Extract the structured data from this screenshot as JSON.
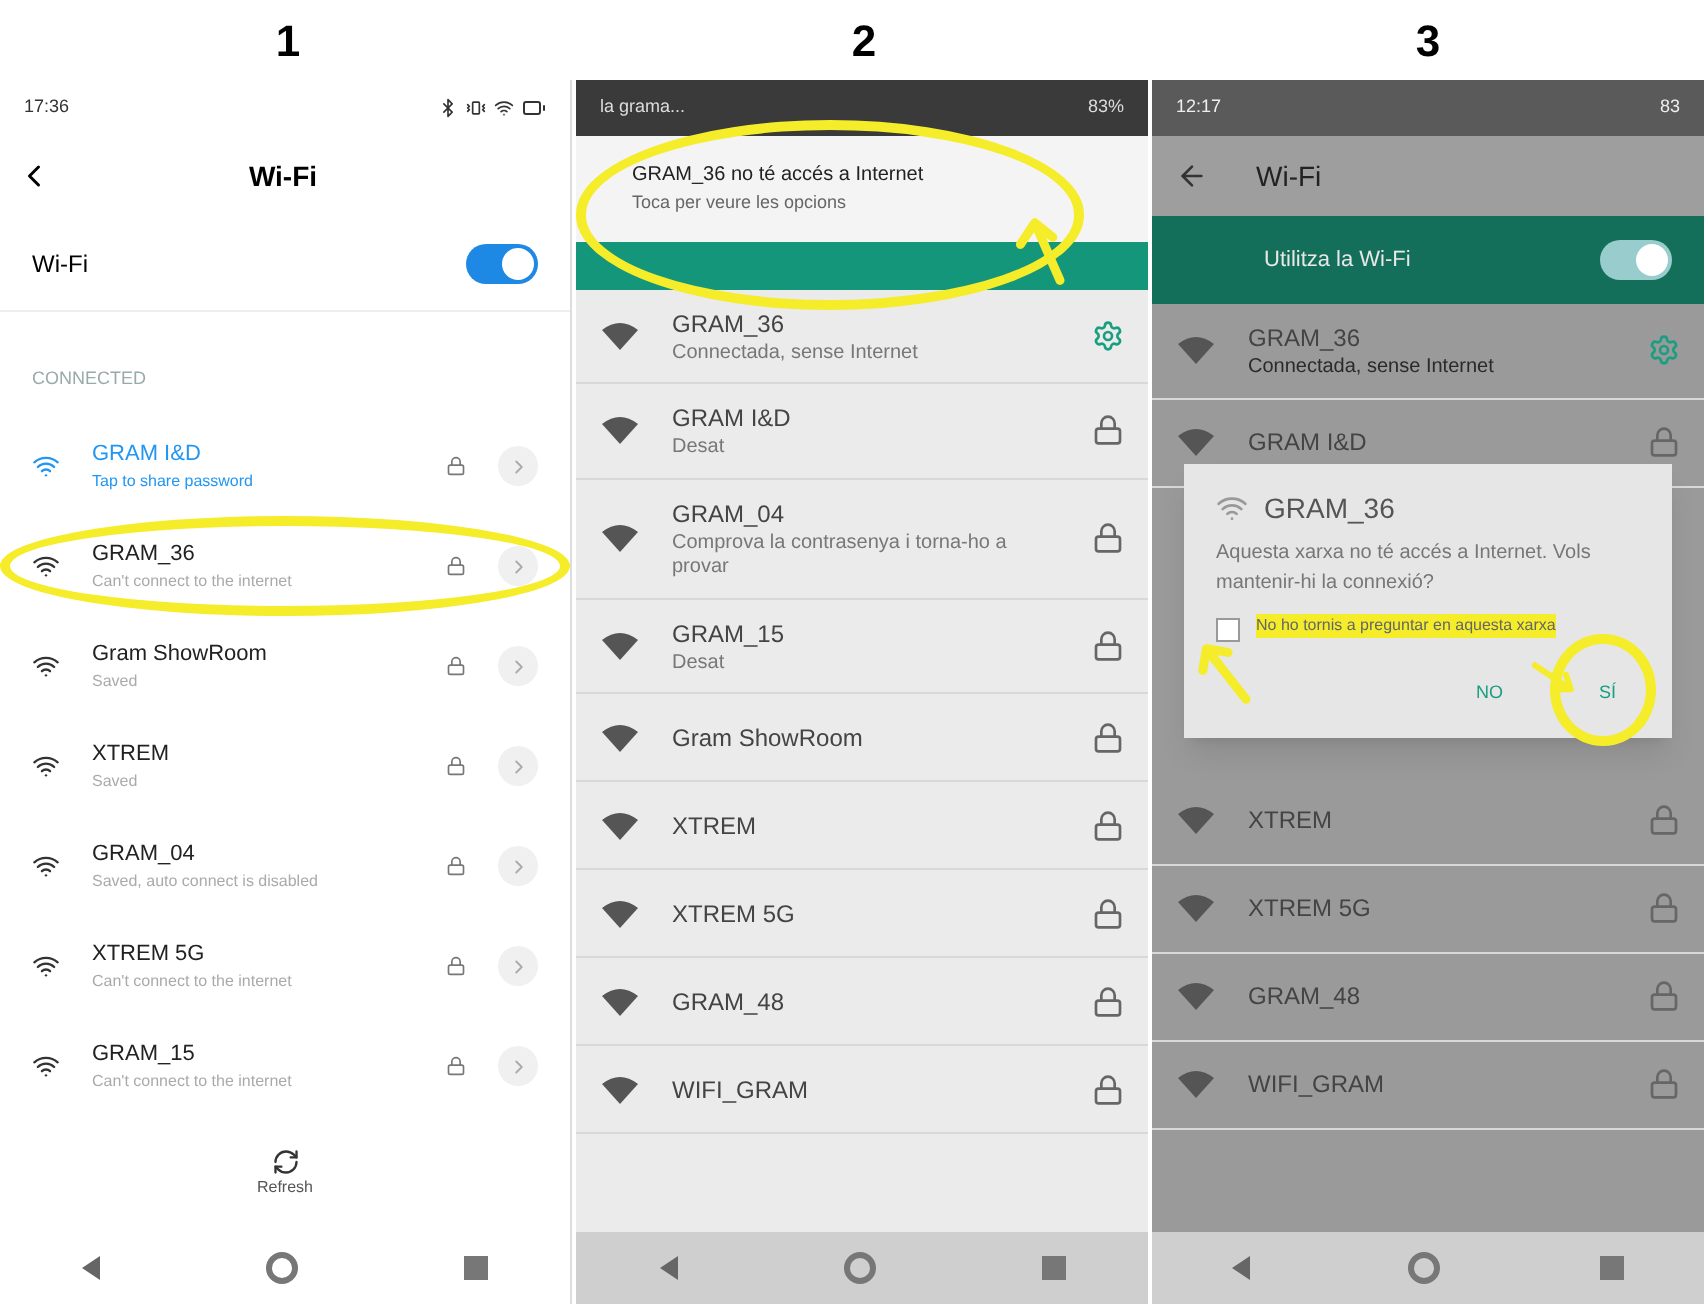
{
  "screens": [
    {
      "kind": "miui",
      "number": "1",
      "status_time": "17:36",
      "title": "Wi-Fi",
      "wifi_toggle": {
        "label": "Wi-Fi",
        "on": true
      },
      "section": "CONNECTED",
      "networks": [
        {
          "name": "GRAM I&D",
          "subtitle": "Tap to share password",
          "connected": true,
          "circled": false
        },
        {
          "name": "GRAM_36",
          "subtitle": "Can't connect to the internet",
          "connected": false,
          "circled": true
        },
        {
          "name": "Gram ShowRoom",
          "subtitle": "Saved",
          "connected": false,
          "circled": false
        },
        {
          "name": "XTREM",
          "subtitle": "Saved",
          "connected": false,
          "circled": false
        },
        {
          "name": "GRAM_04",
          "subtitle": "Saved, auto connect is disabled",
          "connected": false,
          "circled": false
        },
        {
          "name": "XTREM 5G",
          "subtitle": "Can't connect to the internet",
          "connected": false,
          "circled": false
        },
        {
          "name": "GRAM_15",
          "subtitle": "Can't connect to the internet",
          "connected": false,
          "circled": false
        }
      ],
      "refresh": "Refresh"
    },
    {
      "kind": "notification",
      "number": "2",
      "status_text": "la grama...",
      "battery": "83%",
      "notification": {
        "title": "GRAM_36 no té accés a Internet",
        "text": "Toca per veure les opcions",
        "circled": true
      },
      "networks": [
        {
          "name": "GRAM_36",
          "subtitle": "Connectada, sense Internet",
          "kind": "gear"
        },
        {
          "name": "GRAM I&D",
          "subtitle": "Desat",
          "kind": "lock"
        },
        {
          "name": "GRAM_04",
          "subtitle": "Comprova la contrasenya i torna-ho a provar",
          "kind": "lock"
        },
        {
          "name": "GRAM_15",
          "subtitle": "Desat",
          "kind": "lock"
        },
        {
          "name": "Gram ShowRoom",
          "kind": "lock"
        },
        {
          "name": "XTREM",
          "kind": "lock"
        },
        {
          "name": "XTREM 5G",
          "kind": "lock"
        },
        {
          "name": "GRAM_48",
          "kind": "lock"
        },
        {
          "name": "WIFI_GRAM",
          "kind": "lock"
        }
      ]
    },
    {
      "kind": "dialog",
      "number": "3",
      "status_time": "12:17",
      "battery": "83",
      "title": "Wi-Fi",
      "wifi_toggle": {
        "label": "Utilitza la Wi-Fi",
        "on": true
      },
      "networks_above": [
        {
          "name": "GRAM_36",
          "subtitle": "Connectada, sense Internet",
          "kind": "gear"
        },
        {
          "name": "GRAM I&D",
          "kind": "lock"
        }
      ],
      "dialog": {
        "title": "GRAM_36",
        "message": "Aquesta xarxa no té accés a Internet. Vols mantenir-hi la connexió?",
        "checkbox": {
          "label": "No ho tornis a preguntar en aquesta xarxa",
          "checked": false,
          "highlighted": true
        },
        "buttons": [
          {
            "label": "NO",
            "circled": false
          },
          {
            "label": "SÍ",
            "circled": true
          }
        ]
      },
      "networks_below": [
        {
          "name": "XTREM",
          "kind": "lock"
        },
        {
          "name": "XTREM 5G",
          "kind": "lock"
        },
        {
          "name": "GRAM_48",
          "kind": "lock"
        },
        {
          "name": "WIFI_GRAM",
          "kind": "lock"
        }
      ]
    }
  ]
}
